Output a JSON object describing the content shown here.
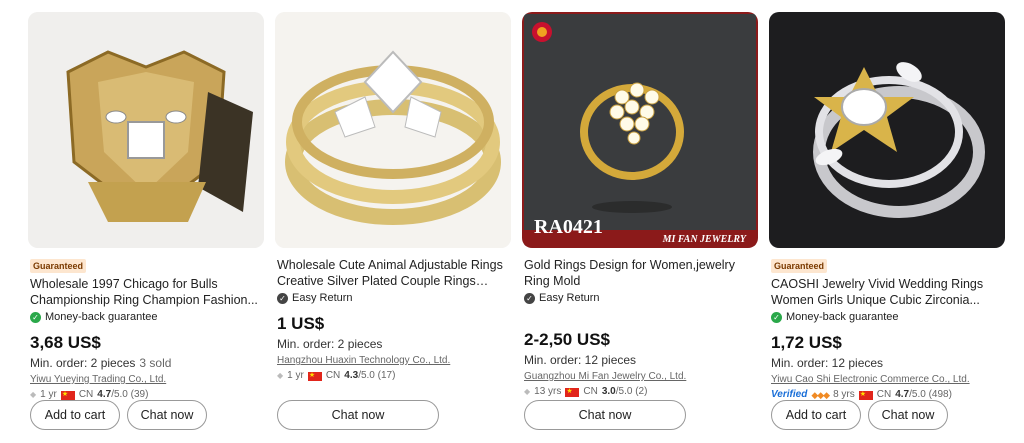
{
  "products": [
    {
      "badge": "Guaranteed",
      "title": "Wholesale 1997 Chicago for Bulls Championship Ring Champion Fashion...",
      "guarantee": "Money-back guarantee",
      "price": "3,68 US$",
      "moq": "Min. order: 2 pieces",
      "sold": "3 sold",
      "company": "Yiwu Yueying Trading Co., Ltd.",
      "years": "1 yr",
      "country": "CN",
      "rating": "4.7",
      "rating_max": "/5.0",
      "reviews": "(39)",
      "buttons": [
        "Add to cart",
        "Chat now"
      ]
    },
    {
      "title": "Wholesale Cute Animal Adjustable Rings Creative Silver Plated Couple Rings Fashion Simple Cartoon Cat Men and...",
      "guarantee": "Easy Return",
      "price": "1 US$",
      "moq": "Min. order: 2 pieces",
      "company": "Hangzhou Huaxin Technology Co., Ltd.",
      "years": "1 yr",
      "country": "CN",
      "rating": "4.3",
      "rating_max": "/5.0",
      "reviews": "(17)",
      "buttons": [
        "Chat now"
      ]
    },
    {
      "title": "Gold Rings Design for Women,jewelry Ring Mold",
      "guarantee": "Easy Return",
      "price": "2-2,50 US$",
      "moq": "Min. order: 12 pieces",
      "company": "Guangzhou Mi Fan Jewelry Co., Ltd.",
      "years": "13 yrs",
      "country": "CN",
      "rating": "3.0",
      "rating_max": "/5.0",
      "reviews": "(2)",
      "image_code": "RA0421",
      "image_brand": "MI FAN JEWELRY",
      "buttons": [
        "Chat now"
      ]
    },
    {
      "badge": "Guaranteed",
      "title": "CAOSHI Jewelry Vivid Wedding Rings Women Girls Unique Cubic Zirconia...",
      "guarantee": "Money-back guarantee",
      "price": "1,72 US$",
      "moq": "Min. order: 12 pieces",
      "company": "Yiwu Cao Shi Electronic Commerce Co., Ltd.",
      "verified": "Verified",
      "years": "8 yrs",
      "country": "CN",
      "rating": "4.7",
      "rating_max": "/5.0",
      "reviews": "(498)",
      "buttons": [
        "Add to cart",
        "Chat now"
      ]
    }
  ],
  "colors": {
    "accent_green": "#2aa84a",
    "badge_bg": "#fde6cf",
    "verified_blue": "#1a6fd8"
  }
}
